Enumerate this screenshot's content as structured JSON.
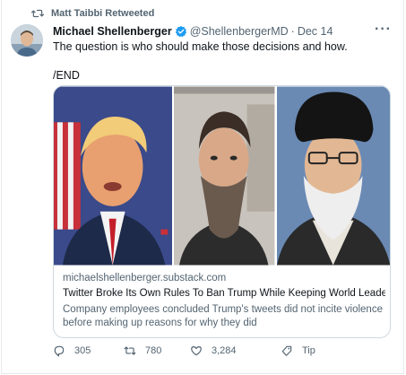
{
  "retweet": {
    "label": "Matt Taibbi Retweeted"
  },
  "tweet": {
    "author_name": "Michael Shellenberger",
    "handle": "@ShellenbergerMD",
    "separator": "·",
    "date": "Dec 14",
    "text_line1": "The question is who should make those decisions and how.",
    "text_line2": "/END"
  },
  "card": {
    "domain": "michaelshellenberger.substack.com",
    "title": "Twitter Broke Its Own Rules To Ban Trump While Keeping World Leade...",
    "description": "Company employees concluded Trump's tweets did not incite violence before making up reasons for why they did"
  },
  "actions": {
    "replies": "305",
    "retweets": "780",
    "likes": "3,284",
    "tip": "Tip"
  },
  "colors": {
    "verified": "#1d9bf0",
    "muted_text": "#536471",
    "primary_text": "#0f1419"
  },
  "icons": [
    "retweet-icon",
    "verified-badge-icon",
    "more-icon",
    "reply-icon",
    "retweet-icon",
    "like-icon",
    "tip-icon"
  ]
}
